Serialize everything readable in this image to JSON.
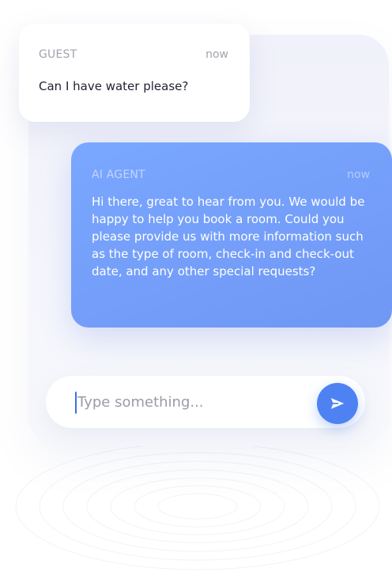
{
  "guest_message": {
    "role": "GUEST",
    "time": "now",
    "text": "Can I have water please?"
  },
  "agent_message": {
    "role": "AI AGENT",
    "time": "now",
    "text": "Hi there, great to hear from you. We would be happy to help you book a room. Could you please provide us with more information such as the type of room, check-in and check-out date, and any other special requests?"
  },
  "composer": {
    "placeholder": "Type something...",
    "send_icon": "send-icon"
  },
  "colors": {
    "accent": "#4e82f2",
    "agent_bubble": "#7aa7ff",
    "guest_bubble": "#ffffff",
    "muted_text": "#a1a3ad"
  }
}
